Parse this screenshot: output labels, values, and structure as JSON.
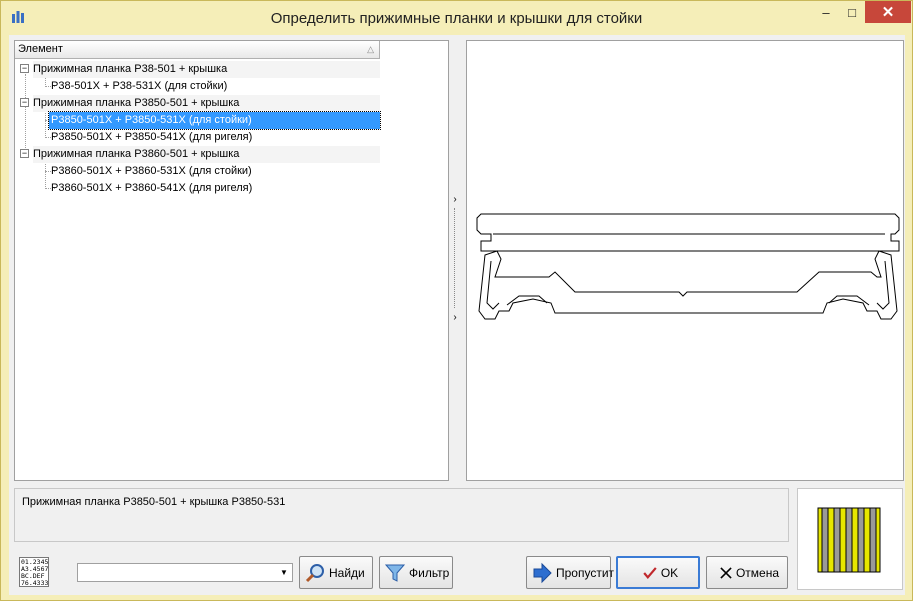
{
  "window": {
    "title": "Определить прижимные планки и крышки для стойки",
    "close_glyph": "✕",
    "max_glyph": "□",
    "min_glyph": "–"
  },
  "tree": {
    "header": "Элемент",
    "groups": [
      {
        "label": "Прижимная планка P38-501 + крышка",
        "children": [
          "P38-501X + P38-531X (для стойки)"
        ]
      },
      {
        "label": "Прижимная планка P3850-501 + крышка",
        "children": [
          "P3850-501X + P3850-531X (для стойки)",
          "P3850-501X + P3850-541X (для ригеля)"
        ]
      },
      {
        "label": "Прижимная планка P3860-501 + крышка",
        "children": [
          "P3860-501X + P3860-531X (для стойки)",
          "P3860-501X + P3860-541X (для ригеля)"
        ]
      }
    ],
    "selected": "P3850-501X + P3850-531X (для стойки)"
  },
  "description": "Прижимная планка P3850-501 + крышка P3850-531",
  "calc_icon_text": [
    "01.2345",
    "A3.4567",
    "BC.DEF",
    "76.4333"
  ],
  "combo": {
    "value": ""
  },
  "buttons": {
    "find": "Найди",
    "filter": "Фильтр",
    "skip": "Пропустит",
    "ok": "OK",
    "cancel": "Отмена"
  },
  "colors": {
    "frame": "#f5eeb8",
    "selection": "#3399ff",
    "close": "#c7473a",
    "thumb_bar": "#e6e600"
  },
  "icons": {
    "app": "bar-chart-icon",
    "find": "magnifier-icon",
    "filter": "funnel-icon",
    "skip": "arrow-right-icon",
    "ok": "check-icon",
    "cancel": "x-icon"
  }
}
